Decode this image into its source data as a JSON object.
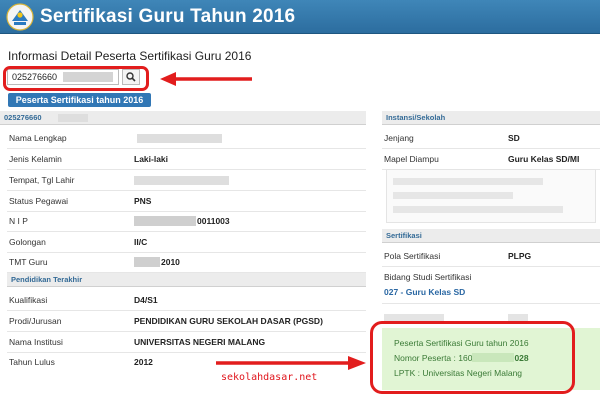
{
  "header": {
    "title": "Sertifikasi Guru Tahun 2016"
  },
  "page": {
    "title": "Informasi Detail Peserta Sertifikasi Guru 2016"
  },
  "search": {
    "value": "025276660"
  },
  "tab": {
    "label": "Peserta Sertifikasi tahun 2016"
  },
  "left": {
    "section_id": "025276660",
    "rows": [
      {
        "label": "Nama Lengkap",
        "value": ""
      },
      {
        "label": "Jenis Kelamin",
        "value": "Laki-laki"
      },
      {
        "label": "Tempat, Tgl Lahir",
        "value": ""
      },
      {
        "label": "Status Pegawai",
        "value": "PNS"
      },
      {
        "label": "N I P",
        "value": "0011003"
      },
      {
        "label": "Golongan",
        "value": "II/C"
      },
      {
        "label": "TMT Guru",
        "value": "2010"
      }
    ],
    "pendidikan": {
      "title": "Pendidikan Terakhir",
      "rows": [
        {
          "label": "Kualifikasi",
          "value": "D4/S1"
        },
        {
          "label": "Prodi/Jurusan",
          "value": "PENDIDIKAN GURU SEKOLAH DASAR (PGSD)"
        },
        {
          "label": "Nama Institusi",
          "value": "UNIVERSITAS NEGERI MALANG"
        },
        {
          "label": "Tahun Lulus",
          "value": "2012"
        }
      ]
    }
  },
  "right": {
    "instansi_title": "Instansi/Sekolah",
    "jenjang": {
      "label": "Jenjang",
      "value": "SD"
    },
    "mapel": {
      "label": "Mapel Diampu",
      "value": "Guru Kelas SD/MI"
    },
    "sertifikasi_title": "Sertifikasi",
    "pola": {
      "label": "Pola Sertifikasi",
      "value": "PLPG"
    },
    "bidang": {
      "label": "Bidang Studi Sertifikasi",
      "value": "027 - Guru Kelas SD"
    }
  },
  "result": {
    "line1": "Peserta Sertifikasi Guru tahun 2016",
    "line2_prefix": "Nomor Peserta : 160",
    "line2_suffix": "028",
    "line3": "LPTK : Universitas Negeri Malang"
  },
  "watermark": "sekolahdasar.net",
  "colors": {
    "header": "#2c6d9f",
    "accent": "#3177b5",
    "annotation": "#e21d1d",
    "result_bg": "#e1f5d4"
  }
}
